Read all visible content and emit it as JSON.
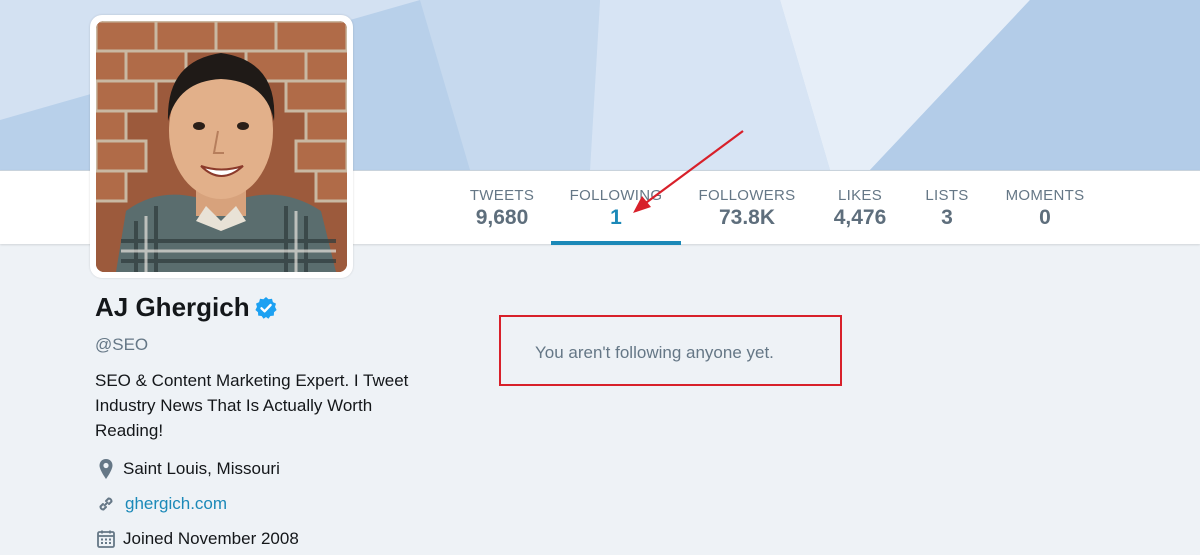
{
  "profile": {
    "name": "AJ Ghergich",
    "handle": "@SEO",
    "bio": "SEO & Content Marketing Expert. I Tweet Industry News That Is Actually Worth Reading!",
    "location": "Saint Louis, Missouri",
    "website": "ghergich.com",
    "joined": "Joined November 2008"
  },
  "stats": [
    {
      "label": "TWEETS",
      "value": "9,680"
    },
    {
      "label": "FOLLOWING",
      "value": "1"
    },
    {
      "label": "FOLLOWERS",
      "value": "73.8K"
    },
    {
      "label": "LIKES",
      "value": "4,476"
    },
    {
      "label": "LISTS",
      "value": "3"
    },
    {
      "label": "MOMENTS",
      "value": "0"
    }
  ],
  "main": {
    "empty_message": "You aren't following anyone yet."
  },
  "colors": {
    "accent": "#1b89b8",
    "annotation": "#d8202a",
    "banner": "#b8d0ea"
  },
  "icons": {
    "verified": "verified-badge-icon",
    "location": "location-pin-icon",
    "link": "link-icon",
    "calendar": "calendar-icon"
  }
}
